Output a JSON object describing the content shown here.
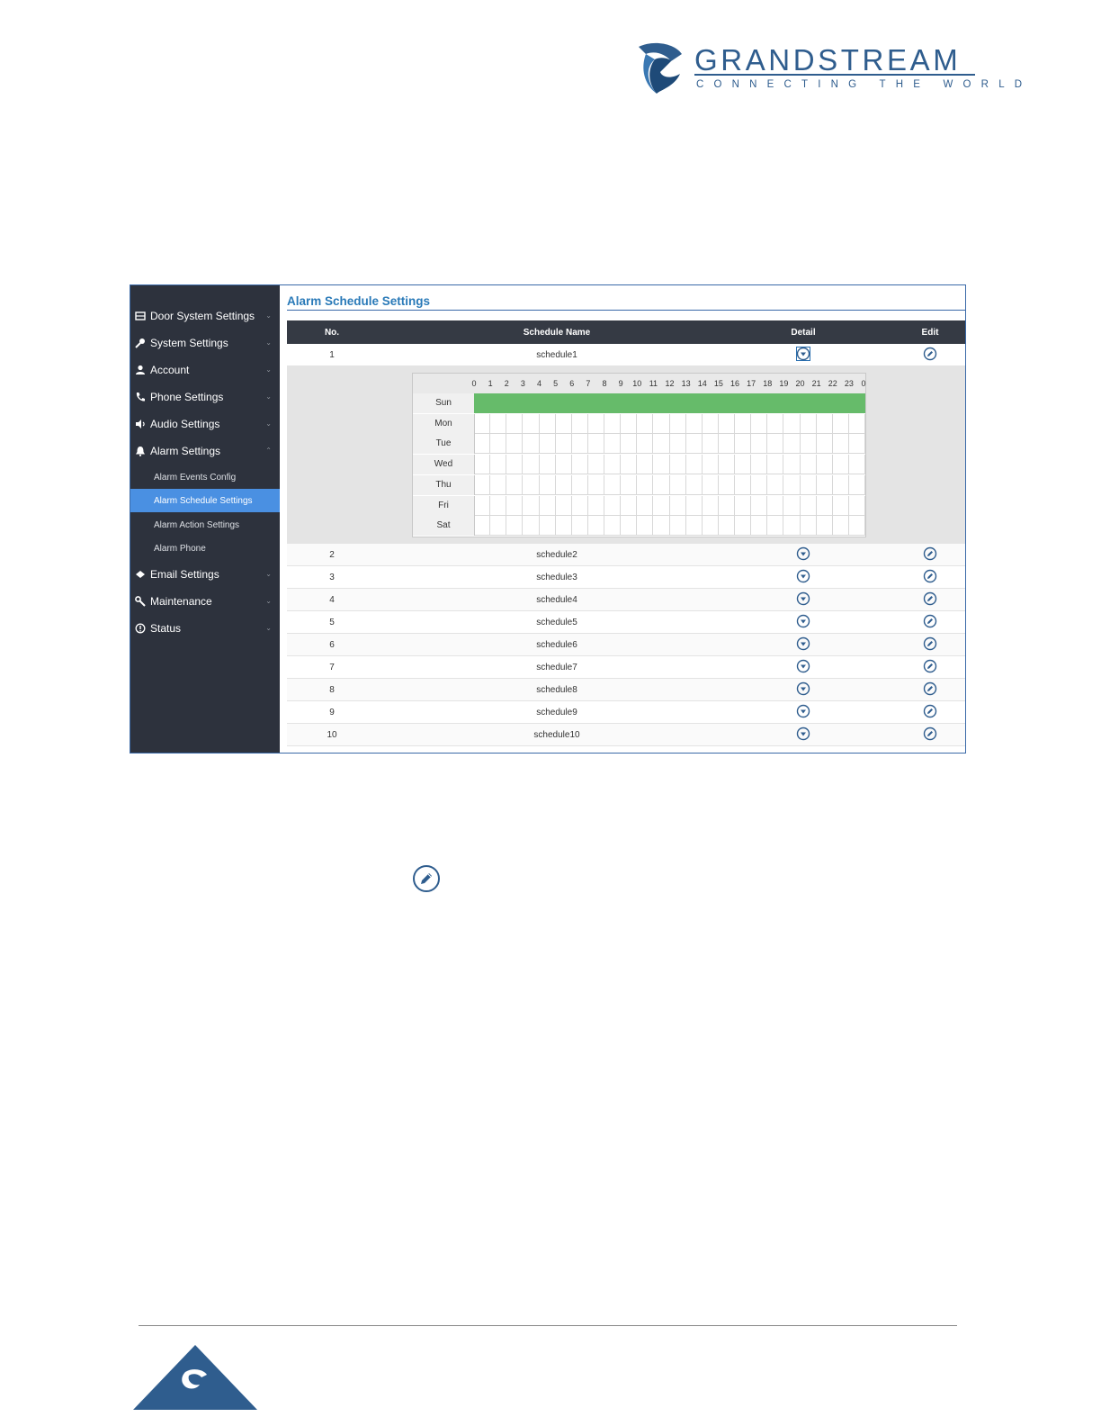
{
  "brand": {
    "name": "GRANDSTREAM",
    "tagline": "CONNECTING THE WORLD",
    "color": "#2f5d8e"
  },
  "sidebar": {
    "items": [
      {
        "label": "Door System Settings",
        "icon": "door-icon"
      },
      {
        "label": "System Settings",
        "icon": "key-icon"
      },
      {
        "label": "Account",
        "icon": "user-icon"
      },
      {
        "label": "Phone Settings",
        "icon": "phone-icon"
      },
      {
        "label": "Audio Settings",
        "icon": "speaker-icon"
      },
      {
        "label": "Alarm Settings",
        "icon": "alarm-icon"
      },
      {
        "label": "Email Settings",
        "icon": "email-icon"
      },
      {
        "label": "Maintenance",
        "icon": "wrench-icon"
      },
      {
        "label": "Status",
        "icon": "info-icon"
      }
    ],
    "alarm_subitems": [
      {
        "label": "Alarm Events Config",
        "active": false
      },
      {
        "label": "Alarm Schedule Settings",
        "active": true
      },
      {
        "label": "Alarm Action Settings",
        "active": false
      },
      {
        "label": "Alarm Phone",
        "active": false
      }
    ],
    "active_color": "#4a90e2"
  },
  "main": {
    "title": "Alarm Schedule Settings",
    "columns": {
      "no": "No.",
      "name": "Schedule Name",
      "detail": "Detail",
      "edit": "Edit"
    },
    "rows": [
      {
        "no": "1",
        "name": "schedule1"
      },
      {
        "no": "2",
        "name": "schedule2"
      },
      {
        "no": "3",
        "name": "schedule3"
      },
      {
        "no": "4",
        "name": "schedule4"
      },
      {
        "no": "5",
        "name": "schedule5"
      },
      {
        "no": "6",
        "name": "schedule6"
      },
      {
        "no": "7",
        "name": "schedule7"
      },
      {
        "no": "8",
        "name": "schedule8"
      },
      {
        "no": "9",
        "name": "schedule9"
      },
      {
        "no": "10",
        "name": "schedule10"
      }
    ],
    "detail": {
      "hours": [
        "0",
        "1",
        "2",
        "3",
        "4",
        "5",
        "6",
        "7",
        "8",
        "9",
        "10",
        "11",
        "12",
        "13",
        "14",
        "15",
        "16",
        "17",
        "18",
        "19",
        "20",
        "21",
        "22",
        "23",
        "0"
      ],
      "days": [
        {
          "label": "Sun",
          "active": true
        },
        {
          "label": "Mon",
          "active": false
        },
        {
          "label": "Tue",
          "active": false
        },
        {
          "label": "Wed",
          "active": false
        },
        {
          "label": "Thu",
          "active": false
        },
        {
          "label": "Fri",
          "active": false
        },
        {
          "label": "Sat",
          "active": false
        }
      ],
      "active_color": "#66bb6a"
    }
  }
}
